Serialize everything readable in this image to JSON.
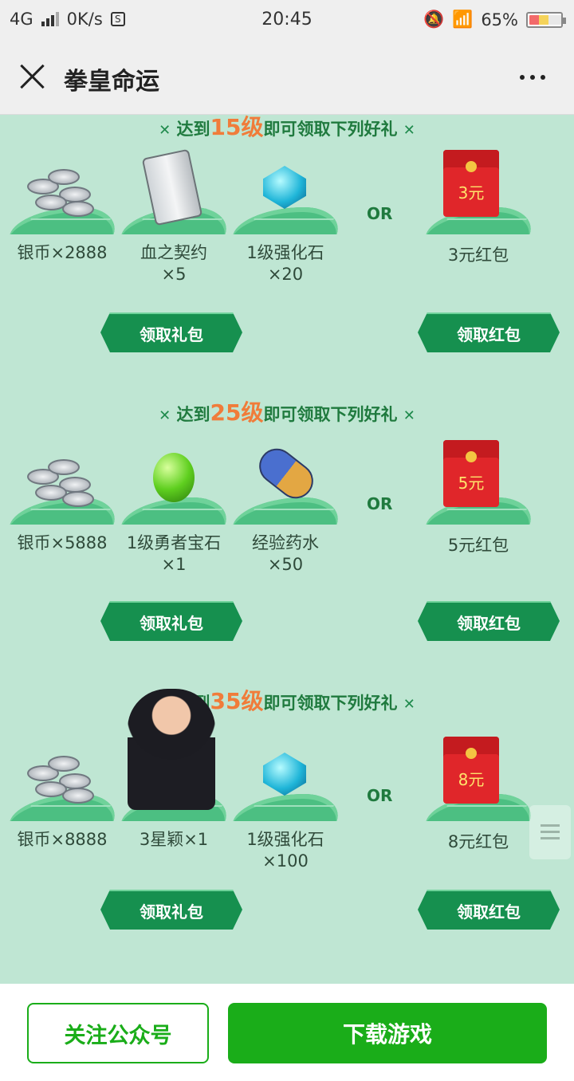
{
  "status_bar": {
    "network": "4G",
    "speed": "0K/s",
    "time": "20:45",
    "battery": "65%"
  },
  "nav": {
    "title": "拳皇命运"
  },
  "sections": [
    {
      "header": {
        "prefix": "达到",
        "level": "15级",
        "suffix": "即可领取下列好礼"
      },
      "items": [
        {
          "icon": "silver-coins-icon",
          "label": "银币×2888"
        },
        {
          "icon": "blood-contract-scroll-icon",
          "label": "血之契约\n×5"
        },
        {
          "icon": "enhance-stone-icon",
          "label": "1级强化石\n×20"
        }
      ],
      "or": "OR",
      "redpacket": {
        "amount": "3元",
        "label": "3元红包"
      },
      "gift_button": "领取礼包",
      "red_button": "领取红包"
    },
    {
      "header": {
        "prefix": "达到",
        "level": "25级",
        "suffix": "即可领取下列好礼"
      },
      "items": [
        {
          "icon": "silver-coins-icon",
          "label": "银币×5888"
        },
        {
          "icon": "brave-gem-icon",
          "label": "1级勇者宝石\n×1"
        },
        {
          "icon": "exp-potion-icon",
          "label": "经验药水\n×50"
        }
      ],
      "or": "OR",
      "redpacket": {
        "amount": "5元",
        "label": "5元红包"
      },
      "gift_button": "领取礼包",
      "red_button": "领取红包"
    },
    {
      "header": {
        "prefix": "达到",
        "level": "35级",
        "suffix": "即可领取下列好礼"
      },
      "items": [
        {
          "icon": "silver-coins-icon",
          "label": "银币×8888"
        },
        {
          "icon": "hero-portrait-icon",
          "label": "3星颖×1"
        },
        {
          "icon": "enhance-stone-icon",
          "label": "1级强化石\n×100"
        }
      ],
      "or": "OR",
      "redpacket": {
        "amount": "8元",
        "label": "8元红包"
      },
      "gift_button": "领取礼包",
      "red_button": "领取红包"
    }
  ],
  "bottom": {
    "follow": "关注公众号",
    "download": "下载游戏"
  }
}
